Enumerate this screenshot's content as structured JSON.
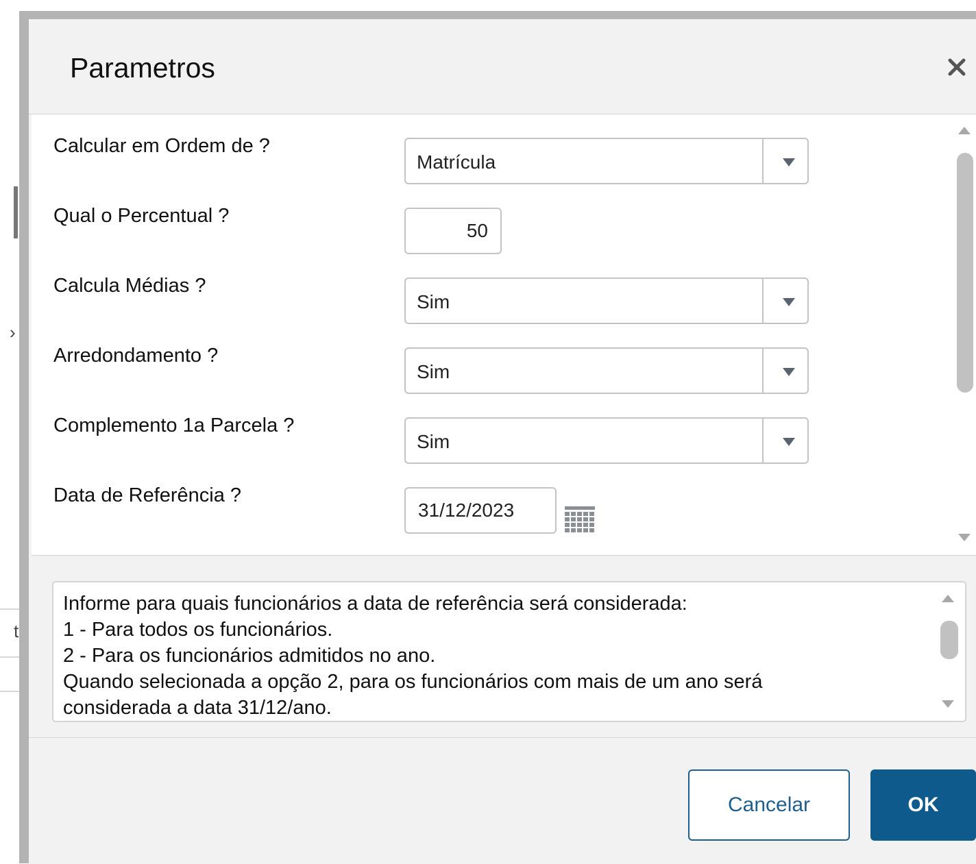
{
  "dialog": {
    "title": "Parametros",
    "close_icon": "close-icon"
  },
  "background": {
    "char1": "›",
    "char2": "t"
  },
  "form": {
    "fields": [
      {
        "label": "Calcular em Ordem de ?",
        "type": "select",
        "value": "Matrícula"
      },
      {
        "label": "Qual o Percentual ?",
        "type": "number",
        "value": "50"
      },
      {
        "label": "Calcula Médias ?",
        "type": "select",
        "value": "Sim"
      },
      {
        "label": "Arredondamento ?",
        "type": "select",
        "value": "Sim"
      },
      {
        "label": "Complemento 1a Parcela ?",
        "type": "select",
        "value": "Sim"
      },
      {
        "label": "Data de Referência ?",
        "type": "date",
        "value": "31/12/2023"
      }
    ]
  },
  "help": {
    "lines": [
      "Informe para quais funcionários a data de referência será considerada:",
      "1 - Para todos os funcionários.",
      "2 - Para os funcionários admitidos no ano.",
      "Quando selecionada a opção 2, para os funcionários com mais de um ano será",
      "considerada a data 31/12/ano."
    ]
  },
  "footer": {
    "cancel_label": "Cancelar",
    "ok_label": "OK"
  },
  "colors": {
    "primary": "#0e5a8c",
    "dialog_bg": "#f2f2f2",
    "border": "#c4c4c4"
  }
}
